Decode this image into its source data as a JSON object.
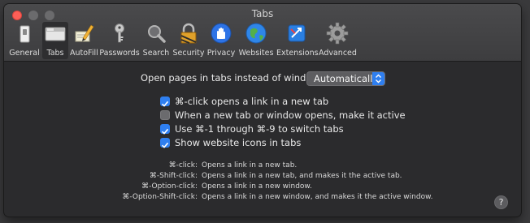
{
  "window": {
    "title": "Tabs"
  },
  "toolbar": {
    "tabs": [
      {
        "label": "General",
        "icon": "general-switch-icon"
      },
      {
        "label": "Tabs",
        "icon": "tabs-icon",
        "selected": true
      },
      {
        "label": "AutoFill",
        "icon": "autofill-pencil-icon"
      },
      {
        "label": "Passwords",
        "icon": "key-icon"
      },
      {
        "label": "Search",
        "icon": "magnifier-icon"
      },
      {
        "label": "Security",
        "icon": "lock-icon"
      },
      {
        "label": "Privacy",
        "icon": "hand-icon"
      },
      {
        "label": "Websites",
        "icon": "globe-icon"
      },
      {
        "label": "Extensions",
        "icon": "puzzle-icon"
      },
      {
        "label": "Advanced",
        "icon": "gear-icon"
      }
    ]
  },
  "open_pages": {
    "label": "Open pages in tabs instead of windows:",
    "selected": "Automatically"
  },
  "options": [
    {
      "label": "⌘-click opens a link in a new tab",
      "checked": true
    },
    {
      "label": "When a new tab or window opens, make it active",
      "checked": false
    },
    {
      "label": "Use ⌘-1 through ⌘-9 to switch tabs",
      "checked": true
    },
    {
      "label": "Show website icons in tabs",
      "checked": true
    }
  ],
  "shortcuts": [
    {
      "key": "⌘-click:",
      "desc": "Opens a link in a new tab."
    },
    {
      "key": "⌘-Shift-click:",
      "desc": "Opens a link in a new tab, and makes it the active tab."
    },
    {
      "key": "⌘-Option-click:",
      "desc": "Opens a link in a new window."
    },
    {
      "key": "⌘-Option-Shift-click:",
      "desc": "Opens a link in a new window, and makes it the active window."
    }
  ],
  "help": {
    "label": "?"
  },
  "colors": {
    "accent": "#2f7ff0",
    "close": "#fe5f57"
  }
}
